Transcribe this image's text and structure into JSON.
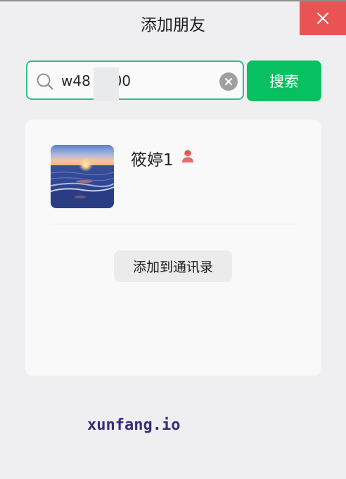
{
  "window": {
    "title": "添加朋友",
    "close_icon": "close-icon",
    "close_color": "#ea5353"
  },
  "search": {
    "query": "w48   700",
    "search_icon": "search-icon",
    "clear_icon": "clear-icon",
    "button_label": "搜索",
    "accent_color": "#07c160"
  },
  "result": {
    "nickname": "筱婷1",
    "gender_icon": "female-user-icon",
    "gender_color": "#ea6b66",
    "avatar": "beach-sunset-avatar",
    "add_button_label": "添加到通讯录"
  },
  "footer": {
    "watermark": "xunfang.io"
  }
}
